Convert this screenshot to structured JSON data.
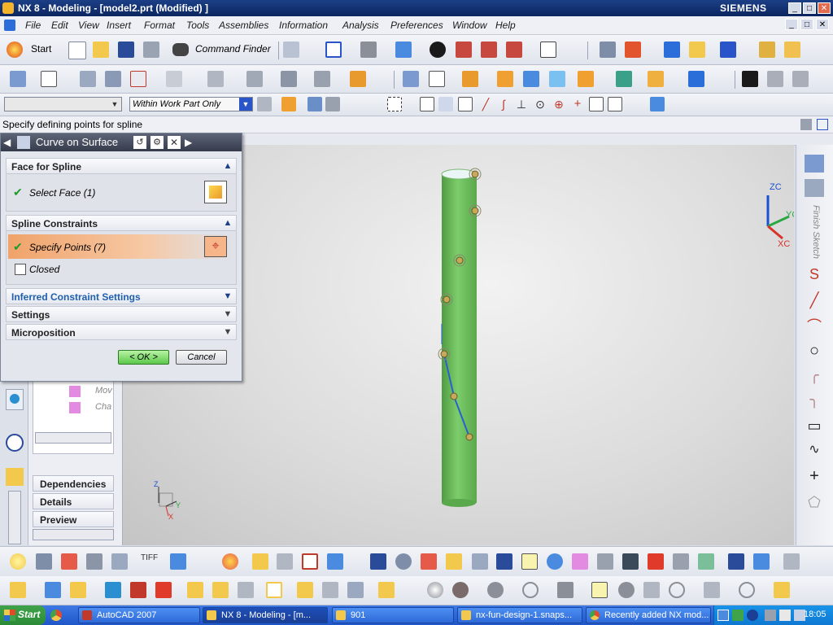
{
  "window": {
    "title": "NX 8 - Modeling - [model2.prt (Modified) ]",
    "brand": "SIEMENS",
    "minimize_glyph": "_",
    "maximize_glyph": "□",
    "close_glyph": "✕"
  },
  "menubar": {
    "items": [
      "File",
      "Edit",
      "View",
      "Insert",
      "Format",
      "Tools",
      "Assemblies",
      "Information",
      "Analysis",
      "Preferences",
      "Window",
      "Help"
    ]
  },
  "toolbar1": {
    "start_label": "Start",
    "command_finder_label": "Command Finder"
  },
  "selection_bar": {
    "type_filter_value": "",
    "scope_value": "Within Work Part Only"
  },
  "cue_line": {
    "text": "Specify defining points for spline"
  },
  "dialog": {
    "title": "Curve on Surface",
    "sections": {
      "face": {
        "label": "Face for Spline",
        "select_face_label": "Select Face (1)"
      },
      "constraints": {
        "label": "Spline Constraints",
        "specify_points_label": "Specify Points (7)",
        "closed_label": "Closed",
        "closed_checked": false
      },
      "inferred": {
        "label": "Inferred Constraint Settings"
      },
      "settings": {
        "label": "Settings"
      },
      "micro": {
        "label": "Microposition"
      }
    },
    "ok_label": "< OK >",
    "cancel_label": "Cancel"
  },
  "part_navigator": {
    "rows": [
      "Mov",
      "Cha"
    ],
    "panels": [
      "Dependencies",
      "Details",
      "Preview"
    ]
  },
  "triad": {
    "view_zc": "ZC",
    "view_yc": "YC",
    "view_xc": "XC",
    "abs_z": "Z",
    "abs_y": "Y",
    "abs_x": "X"
  },
  "right_toolbar": {
    "finish_sketch_label": "Finish Sketch"
  },
  "toolbar_lower": {
    "tiff_label": "TIFF"
  },
  "taskbar": {
    "start_label": "Start",
    "tasks": [
      "AutoCAD 2007",
      "NX 8 - Modeling - [m...",
      "901",
      "nx-fun-design-1.snaps...",
      "Recently added NX mod..."
    ],
    "clock": "18:05"
  },
  "colors": {
    "title_bar": "#0b2660",
    "cylinder_green": "#6cbf5c",
    "spline_blue": "#2a5fd1",
    "highlight_orange": "#f0a36a",
    "taskbar_blue": "#2a62d4"
  }
}
